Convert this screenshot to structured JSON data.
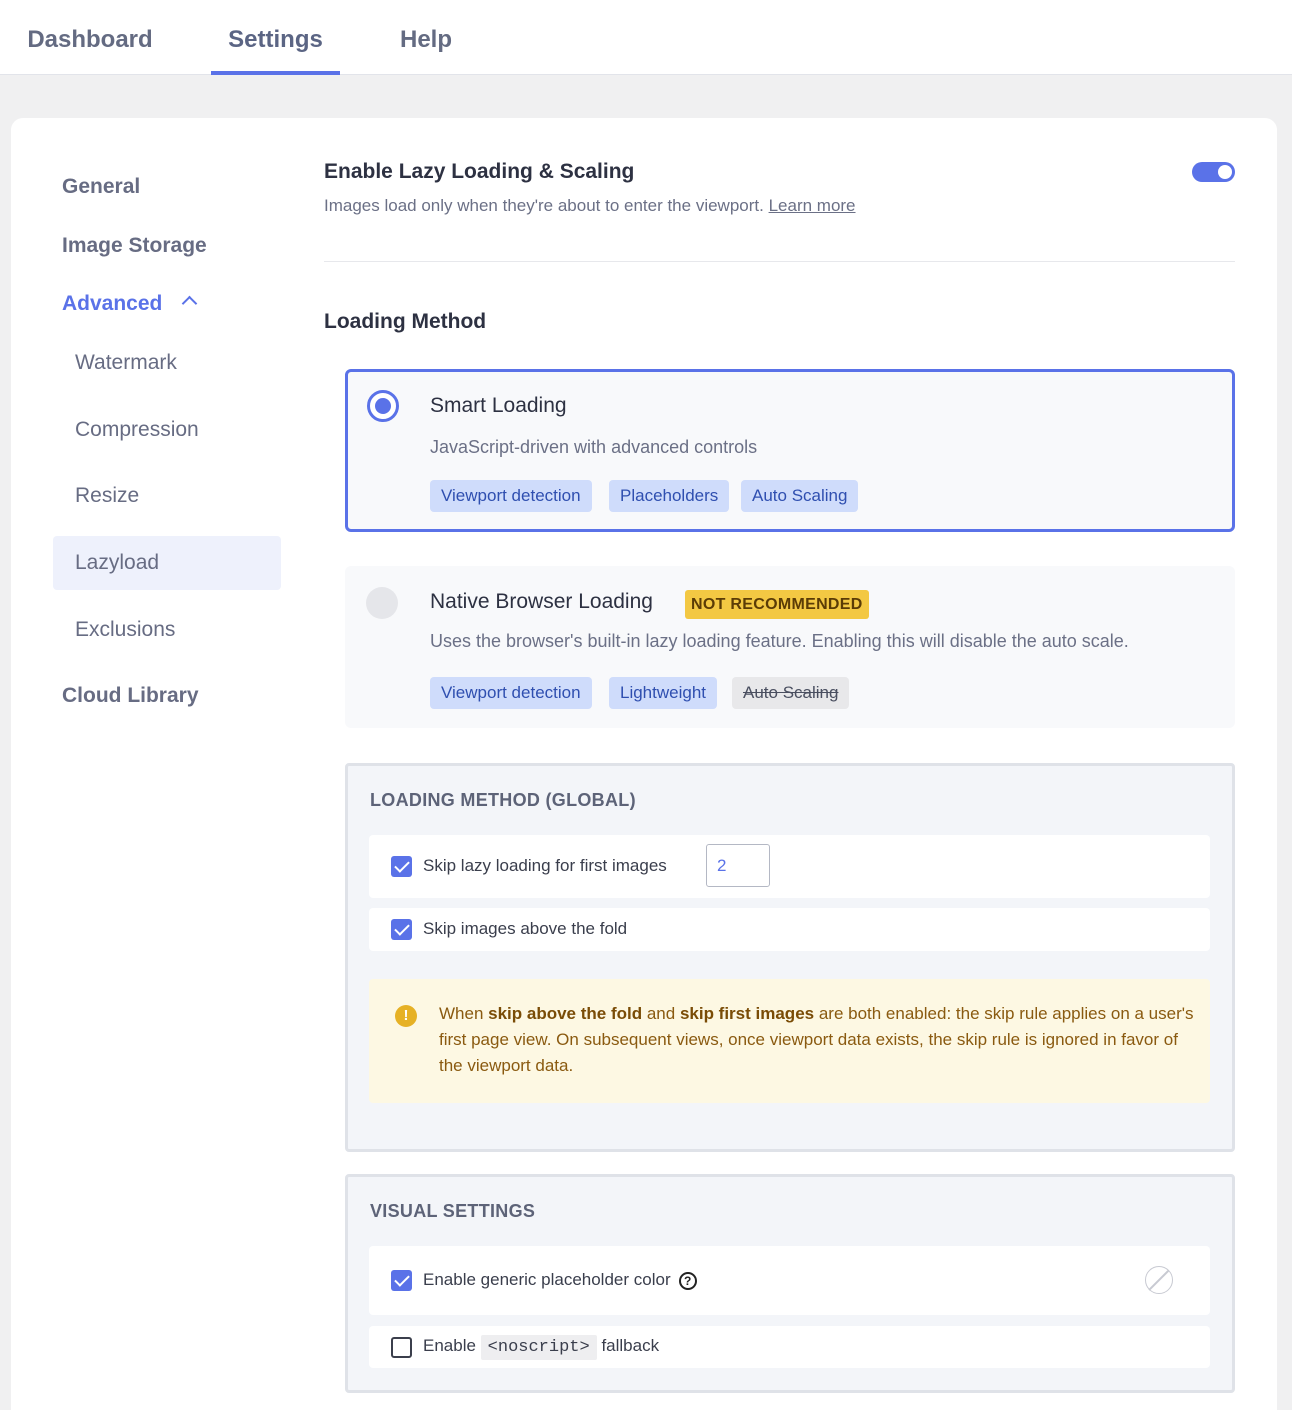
{
  "topnav": {
    "tabs": [
      {
        "label": "Dashboard"
      },
      {
        "label": "Settings"
      },
      {
        "label": "Help"
      }
    ]
  },
  "sidebar": {
    "items": [
      {
        "label": "General"
      },
      {
        "label": "Image Storage"
      },
      {
        "label": "Advanced"
      },
      {
        "label": "Watermark"
      },
      {
        "label": "Compression"
      },
      {
        "label": "Resize"
      },
      {
        "label": "Lazyload"
      },
      {
        "label": "Exclusions"
      },
      {
        "label": "Cloud Library"
      }
    ],
    "active": "Lazyload"
  },
  "header": {
    "title": "Enable Lazy Loading & Scaling",
    "subtitle": "Images load only when they're about to enter the viewport.",
    "learn_more": "Learn more",
    "toggle_on": true
  },
  "loading_method": {
    "title": "Loading Method",
    "smart": {
      "title": "Smart Loading",
      "desc": "JavaScript-driven with advanced controls",
      "tags": [
        "Viewport detection",
        "Placeholders",
        "Auto Scaling"
      ],
      "selected": true
    },
    "native": {
      "title": "Native Browser Loading",
      "badge": "NOT RECOMMENDED",
      "desc": "Uses the browser's built-in lazy loading feature. Enabling this will disable the auto scale.",
      "tags": [
        "Viewport detection",
        "Lightweight",
        "Auto Scaling"
      ],
      "selected": false
    }
  },
  "global_panel": {
    "title": "LOADING METHOD (GLOBAL)",
    "skip_first": {
      "label": "Skip lazy loading for first images",
      "value": "2",
      "checked": true
    },
    "skip_fold": {
      "label": "Skip images above the fold",
      "checked": true
    },
    "warning": {
      "t1": "When ",
      "b1": "skip above the fold",
      "t2": " and ",
      "b2": "skip first images",
      "t3": " are both enabled: the skip rule applies on a user's first page view. On subsequent views, once viewport data exists, the skip rule is ignored in favor of the viewport data."
    }
  },
  "visual_panel": {
    "title": "VISUAL SETTINGS",
    "placeholder_color": {
      "label": "Enable generic placeholder color",
      "checked": true
    },
    "noscript": {
      "pre": "Enable",
      "code": "<noscript>",
      "post": "fallback",
      "checked": false
    }
  },
  "colors": {
    "accent": "#5a72e8",
    "warning_bg": "#fdf8e3",
    "badge": "#f3c843"
  }
}
